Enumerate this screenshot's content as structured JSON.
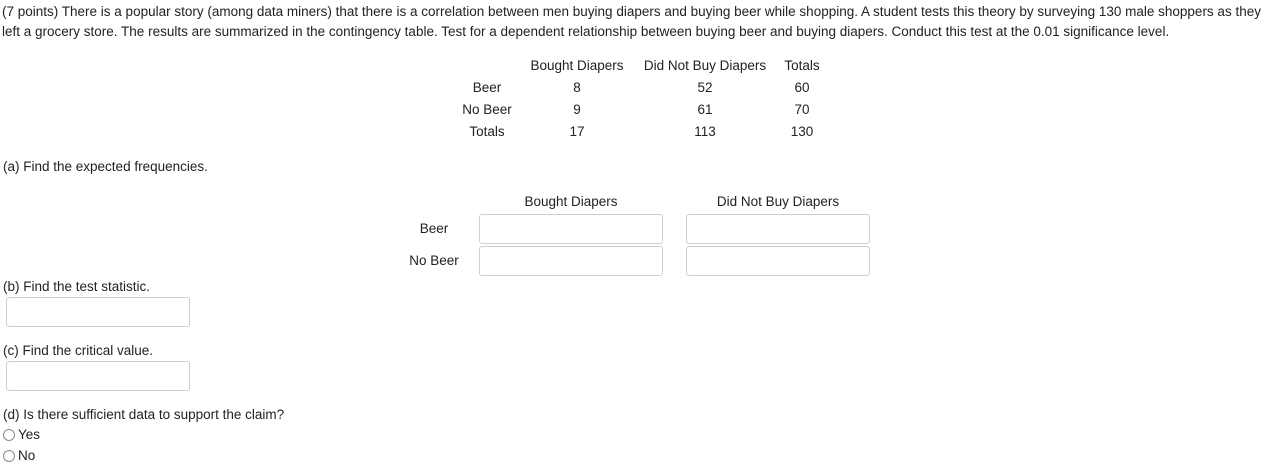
{
  "intro": "(7 points) There is a popular story (among data miners) that there is a correlation between men buying diapers and buying beer while shopping. A student tests this theory by surveying 130 male shoppers as they left a grocery store. The results are summarized in the contingency table. Test for a dependent relationship between buying beer and buying diapers. Conduct this test at the 0.01 significance level.",
  "contingency": {
    "headers": [
      "Bought Diapers",
      "Did Not Buy Diapers",
      "Totals"
    ],
    "rows": [
      {
        "label": "Beer",
        "cells": [
          "8",
          "52",
          "60"
        ]
      },
      {
        "label": "No Beer",
        "cells": [
          "9",
          "61",
          "70"
        ]
      },
      {
        "label": "Totals",
        "cells": [
          "17",
          "113",
          "130"
        ]
      }
    ]
  },
  "part_a": {
    "question": "(a) Find the expected frequencies.",
    "col_headers": [
      "Bought Diapers",
      "Did Not Buy Diapers"
    ],
    "row_labels": [
      "Beer",
      "No Beer"
    ],
    "values": [
      "",
      "",
      "",
      ""
    ]
  },
  "part_b": {
    "question": "(b) Find the test statistic.",
    "value": ""
  },
  "part_c": {
    "question": "(c) Find the critical value.",
    "value": ""
  },
  "part_d": {
    "question": "(d) Is there sufficient data to support the claim?",
    "options": [
      "Yes",
      "No"
    ]
  }
}
